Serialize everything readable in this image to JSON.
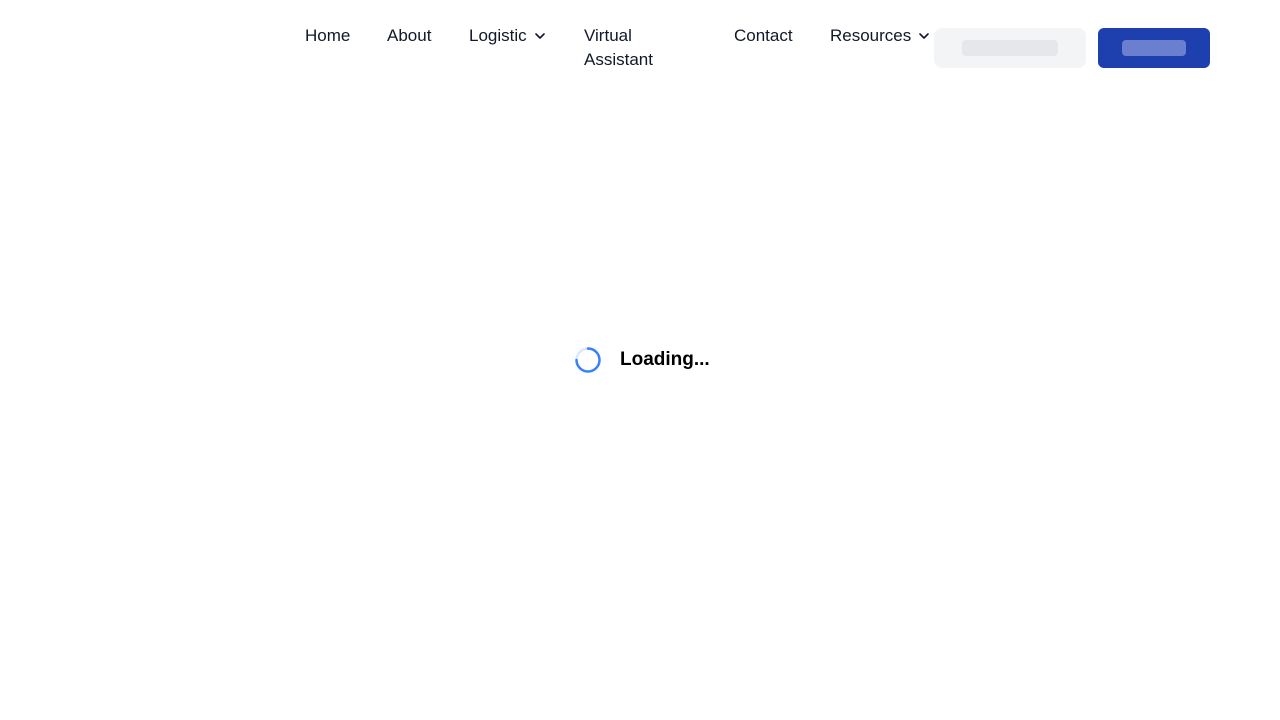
{
  "nav": {
    "items": [
      {
        "label": "Home",
        "has_dropdown": false
      },
      {
        "label": "About",
        "has_dropdown": false
      },
      {
        "label": "Logistic",
        "has_dropdown": true
      },
      {
        "label": "Virtual Assistant",
        "has_dropdown": false
      },
      {
        "label": "Contact",
        "has_dropdown": false
      },
      {
        "label": "Resources",
        "has_dropdown": true
      }
    ]
  },
  "actions": {
    "secondary_button": {
      "state": "loading-placeholder"
    },
    "primary_button": {
      "state": "loading-placeholder",
      "color": "#1e40af"
    }
  },
  "status": {
    "loading_text": "Loading...",
    "spinner_color": "#3b82f6"
  },
  "colors": {
    "background": "#ffffff",
    "text": "#111827",
    "accent": "#1e40af"
  }
}
